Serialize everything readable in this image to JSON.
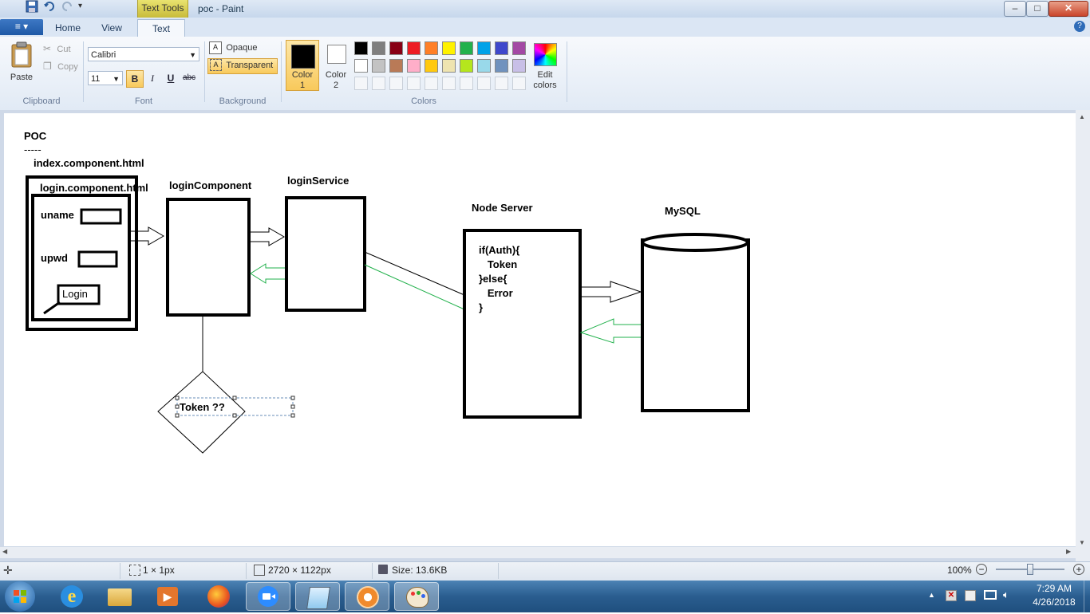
{
  "title_bar": {
    "context_tab": "Text Tools",
    "window_title": "poc - Paint",
    "minimize": "–",
    "maximize": "□",
    "close": "✕"
  },
  "ribbon_tabs": {
    "file": "≡ ▾",
    "home": "Home",
    "view": "View",
    "text": "Text",
    "help": "?"
  },
  "clipboard": {
    "paste": "Paste",
    "cut": "Cut",
    "copy": "Copy",
    "group": "Clipboard"
  },
  "font": {
    "family": "Calibri",
    "size": "11",
    "bold": "B",
    "italic": "I",
    "underline": "U",
    "strike": "abc",
    "group": "Font"
  },
  "background": {
    "opaque": "Opaque",
    "transparent": "Transparent",
    "group": "Background"
  },
  "colors": {
    "color1_line1": "Color",
    "color1_line2": "1",
    "color2_line1": "Color",
    "color2_line2": "2",
    "edit_line1": "Edit",
    "edit_line2": "colors",
    "group": "Colors",
    "color1_value": "#000000",
    "color2_value": "#ffffff",
    "palette_row1": [
      "#000000",
      "#7f7f7f",
      "#880015",
      "#ed1c24",
      "#ff7f27",
      "#fff200",
      "#22b14c",
      "#00a2e8",
      "#3f48cc",
      "#a349a4"
    ],
    "palette_row2": [
      "#ffffff",
      "#c3c3c3",
      "#b97a57",
      "#ffaec9",
      "#ffc90e",
      "#efe4b0",
      "#b5e61d",
      "#99d9ea",
      "#7092be",
      "#c8bfe7"
    ]
  },
  "diagram": {
    "poc": "POC",
    "dashes": "-----",
    "index_label": "index.component.html",
    "login_component_html": "login.component.html",
    "uname": "uname",
    "upwd": "upwd",
    "login_button": "Login",
    "login_component": "loginComponent",
    "login_service": "loginService",
    "node_server": "Node Server",
    "code_line1": "if(Auth){",
    "code_line2": "   Token",
    "code_line3": "}else{",
    "code_line4": "   Error",
    "code_line5": "}",
    "mysql": "MySQL",
    "token_text": "Token ??"
  },
  "status": {
    "selection": "1 × 1px",
    "dimensions": "2720 × 1122px",
    "size": "Size: 13.6KB",
    "zoom": "100%",
    "zoom_level": 1.0
  },
  "taskbar": {
    "time": "7:29 AM",
    "date": "4/26/2018"
  }
}
